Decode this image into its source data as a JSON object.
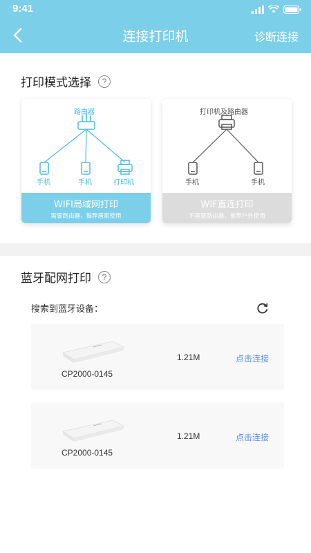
{
  "status": {
    "time": "9:41"
  },
  "nav": {
    "title": "连接打印机",
    "diagnose": "诊断连接"
  },
  "print_mode": {
    "title": "打印模式选择",
    "help": "?",
    "wifi": {
      "router_label": "路由器",
      "phone1": "手机",
      "phone2": "手机",
      "printer": "打印机",
      "title": "WIFI局域网打印",
      "subtitle": "需要路由器，推荐居家使用"
    },
    "direct": {
      "top_label": "打印机及路由器",
      "phone1": "手机",
      "phone2": "手机",
      "title": "WIF直连打印",
      "subtitle": "不需要路由器，推荐户外使用"
    }
  },
  "bluetooth": {
    "title": "蓝牙配网打印",
    "help": "?",
    "search_label": "搜索到蓝牙设备：",
    "devices": [
      {
        "name": "CP2000-0145",
        "size": "1.21M",
        "action": "点击连接"
      },
      {
        "name": "CP2000-0145",
        "size": "1.21M",
        "action": "点击连接"
      }
    ]
  },
  "colors": {
    "accent": "#7ccfe9",
    "link": "#5a8de0",
    "disabled": "#dcdcdc"
  }
}
